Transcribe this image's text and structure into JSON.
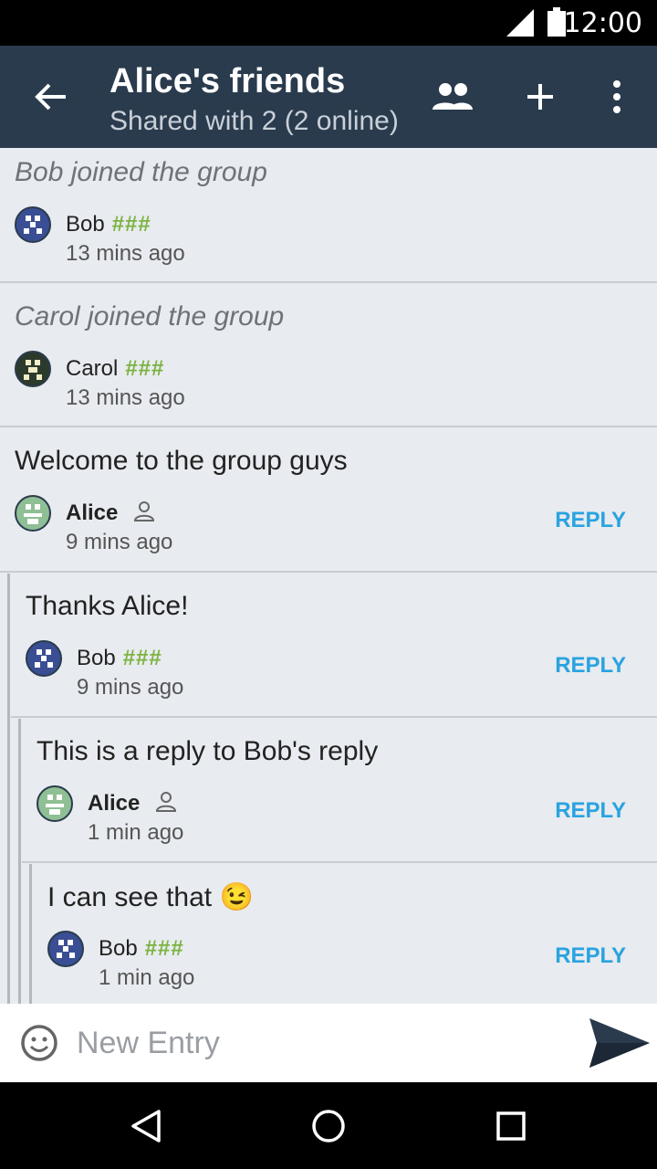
{
  "status": {
    "time": "12:00"
  },
  "appbar": {
    "title": "Alice's friends",
    "subtitle": "Shared with 2 (2 online)"
  },
  "posts": [
    {
      "message": "Bob joined the group",
      "author": "Bob",
      "badge": "###",
      "time": "13 mins ago",
      "system": true
    },
    {
      "message": "Carol joined the group",
      "author": "Carol",
      "badge": "###",
      "time": "13 mins ago",
      "system": true
    },
    {
      "message": "Welcome to the group guys",
      "author": "Alice",
      "time": "9 mins ago",
      "reply": "REPLY"
    },
    {
      "message": "Thanks Alice!",
      "author": "Bob",
      "badge": "###",
      "time": "9 mins ago",
      "reply": "REPLY"
    },
    {
      "message": "This is a reply to Bob's reply",
      "author": "Alice",
      "time": "1 min ago",
      "reply": "REPLY"
    },
    {
      "message": "I can see that 😉",
      "author": "Bob",
      "badge": "###",
      "time": "1 min ago",
      "reply": "REPLY"
    }
  ],
  "composer": {
    "placeholder": "New Entry"
  },
  "colors": {
    "appbar": "#2a3b4e",
    "accent": "#29a3e0",
    "badge": "#7cb342"
  }
}
